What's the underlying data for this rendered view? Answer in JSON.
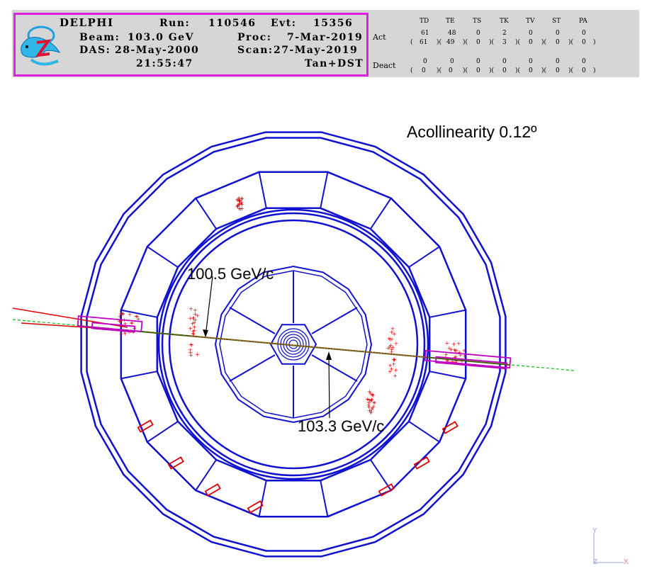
{
  "header": {
    "experiment": "DELPHI",
    "run_label": "Run:",
    "run_value": "110546",
    "evt_label": "Evt:",
    "evt_value": "15356",
    "beam_label": "Beam:",
    "beam_value": "103.0 GeV",
    "proc_label": "Proc:",
    "proc_value": "7-Mar-2019",
    "das_label": "DAS:",
    "das_value": "28-May-2000",
    "scan_label": "Scan:",
    "scan_value": "27-May-2019",
    "time": "21:55:47",
    "data_type": "Tan+DST",
    "logo_icon": "dolphin-logo"
  },
  "detectors": {
    "columns": [
      "TD",
      "TE",
      "TS",
      "TK",
      "TV",
      "ST",
      "PA"
    ],
    "act_label": "Act",
    "act_values": [
      "61",
      "48",
      "0",
      "2",
      "0",
      "0",
      "0"
    ],
    "act_totals": [
      "61",
      "49",
      "0",
      "3",
      "0",
      "0",
      "0"
    ],
    "deact_label": "Deact",
    "deact_values": [
      "0",
      "0",
      "0",
      "0",
      "0",
      "0",
      "0"
    ],
    "deact_totals": [
      "0",
      "0",
      "0",
      "0",
      "0",
      "0",
      "0"
    ]
  },
  "event": {
    "acollinearity": "Acollinearity 0.12º",
    "track1_momentum": "100.5 GeV/c",
    "track2_momentum": "103.3 GeV/c"
  },
  "axes": {
    "y": "Y",
    "z": "Z",
    "x": "X"
  },
  "colors": {
    "detector": "#1010d0",
    "hits": "#e00000",
    "track": "#00c000",
    "muon": "#c000c0",
    "info_border": "#e020e0",
    "header_bg": "#d6d6d6"
  }
}
